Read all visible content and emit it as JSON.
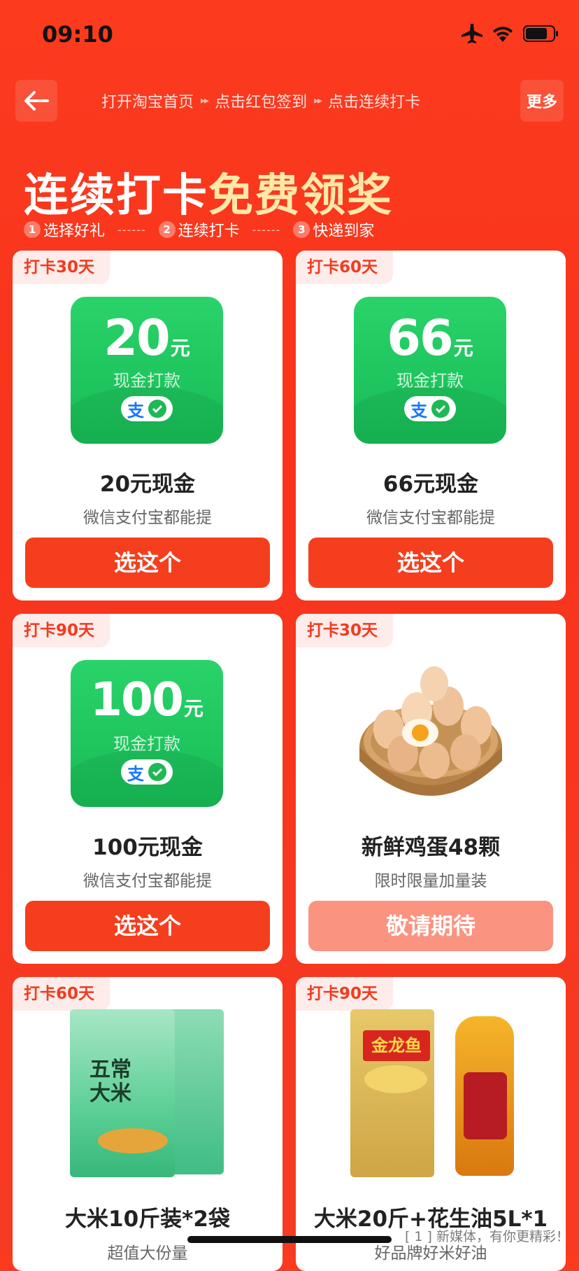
{
  "status": {
    "time": "09:10",
    "icons": [
      "airplane-icon",
      "wifi-icon",
      "battery-icon"
    ]
  },
  "nav": {
    "back_icon": "arrow-left-icon",
    "steps": [
      "打开淘宝首页",
      "点击红包签到",
      "点击连续打卡"
    ],
    "step_arrow": "▸▸",
    "more": "更多"
  },
  "hero": {
    "title_white": "连续打卡",
    "title_yellow": "免费领奖",
    "process": [
      {
        "num": "1",
        "label": "选择好礼"
      },
      {
        "num": "2",
        "label": "连续打卡"
      },
      {
        "num": "3",
        "label": "快递到家"
      }
    ],
    "dash": "------"
  },
  "cards": [
    {
      "badge": "打卡30天",
      "amount": "20",
      "unit": "元",
      "cash_label": "现金打款",
      "name": "20元现金",
      "sub": "微信支付宝都能提",
      "button": "选这个"
    },
    {
      "badge": "打卡60天",
      "amount": "66",
      "unit": "元",
      "cash_label": "现金打款",
      "name": "66元现金",
      "sub": "微信支付宝都能提",
      "button": "选这个"
    },
    {
      "badge": "打卡90天",
      "amount": "100",
      "unit": "元",
      "cash_label": "现金打款",
      "name": "100元现金",
      "sub": "微信支付宝都能提",
      "button": "选这个"
    },
    {
      "badge": "打卡30天",
      "image": "eggs-basket-image",
      "name": "新鲜鸡蛋48颗",
      "sub": "限时限量加量装",
      "button": "敬请期待"
    },
    {
      "badge": "打卡60天",
      "image": "rice-bags-image",
      "image_text": "五常大米",
      "name": "大米10斤装*2袋",
      "sub": "超值大份量"
    },
    {
      "badge": "打卡90天",
      "image": "rice-and-oil-image",
      "image_text": "金龙鱼",
      "name": "大米20斤+花生油5L*1",
      "sub": "好品牌好米好油"
    }
  ],
  "pay_icons": [
    "alipay-icon",
    "wechat-pay-icon"
  ],
  "alipay_char": "支",
  "watermark": "[ 1 ] 新媒体，有你更精彩！",
  "colors": {
    "bg": "#f8341c",
    "button": "#f53e1e",
    "button_disabled": "#fb9381",
    "cash_green": "#1fc45e",
    "title_yellow": "#ffe8a8"
  }
}
